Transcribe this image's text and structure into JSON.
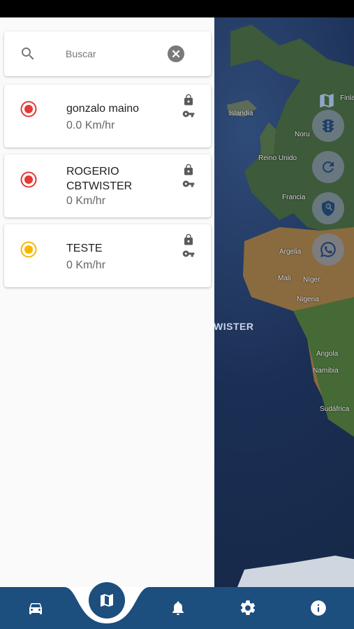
{
  "search": {
    "placeholder": "Buscar"
  },
  "devices": [
    {
      "name": "gonzalo maino",
      "speed": "0.0 Km/hr",
      "status_color": "#e53935"
    },
    {
      "name": "ROGERIO CBTWISTER",
      "speed": "0 Km/hr",
      "status_color": "#e53935"
    },
    {
      "name": "TESTE",
      "speed": "0 Km/hr",
      "status_color": "#f9b800"
    }
  ],
  "map": {
    "labels": [
      "Islandia",
      "Reino Unido",
      "Noru",
      "Francia",
      "Argelia",
      "Mali",
      "Níger",
      "Nigeria",
      "Angola",
      "Namibia",
      "Sudáfrica",
      "Finla"
    ],
    "marker_label": "WISTER"
  },
  "bottom_nav": {
    "items": [
      "car-icon",
      "map-icon",
      "bell-icon",
      "gear-icon",
      "info-icon"
    ]
  },
  "colors": {
    "primary": "#1c4e7e",
    "offline": "#e53935",
    "idle": "#f9b800"
  }
}
